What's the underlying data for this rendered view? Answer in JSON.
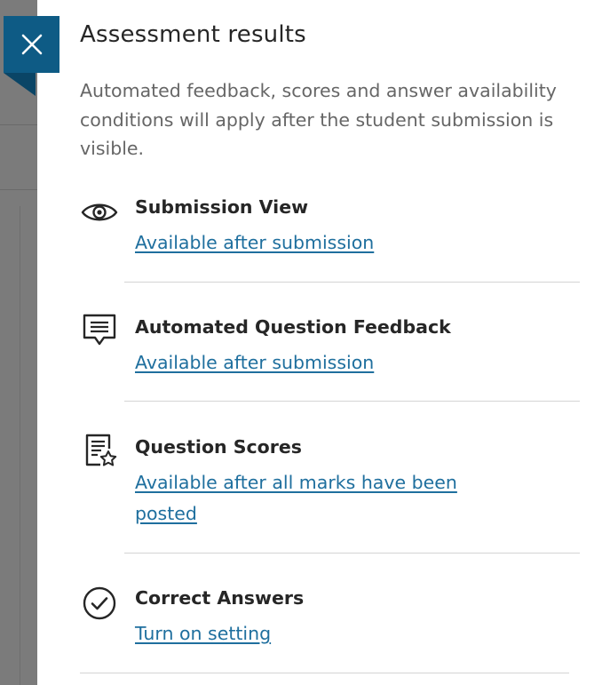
{
  "panel": {
    "title": "Assessment results",
    "description": "Automated feedback, scores and answer availability conditions will apply after the student submission is visible."
  },
  "close_button": {
    "icon": "close-icon"
  },
  "items": [
    {
      "icon": "eye-icon",
      "title": "Submission View",
      "link": "Available after submission"
    },
    {
      "icon": "feedback-icon",
      "title": "Automated Question Feedback",
      "link": "Available after submission"
    },
    {
      "icon": "scores-icon",
      "title": "Question Scores",
      "link": "Available after all marks have been posted"
    },
    {
      "icon": "check-circle-icon",
      "title": "Correct Answers",
      "link": "Turn on setting"
    }
  ],
  "colors": {
    "accent": "#0e5b85",
    "link": "#1f6f9e",
    "text": "#262626",
    "muted": "#666666",
    "backdrop": "#7b7b7b"
  }
}
